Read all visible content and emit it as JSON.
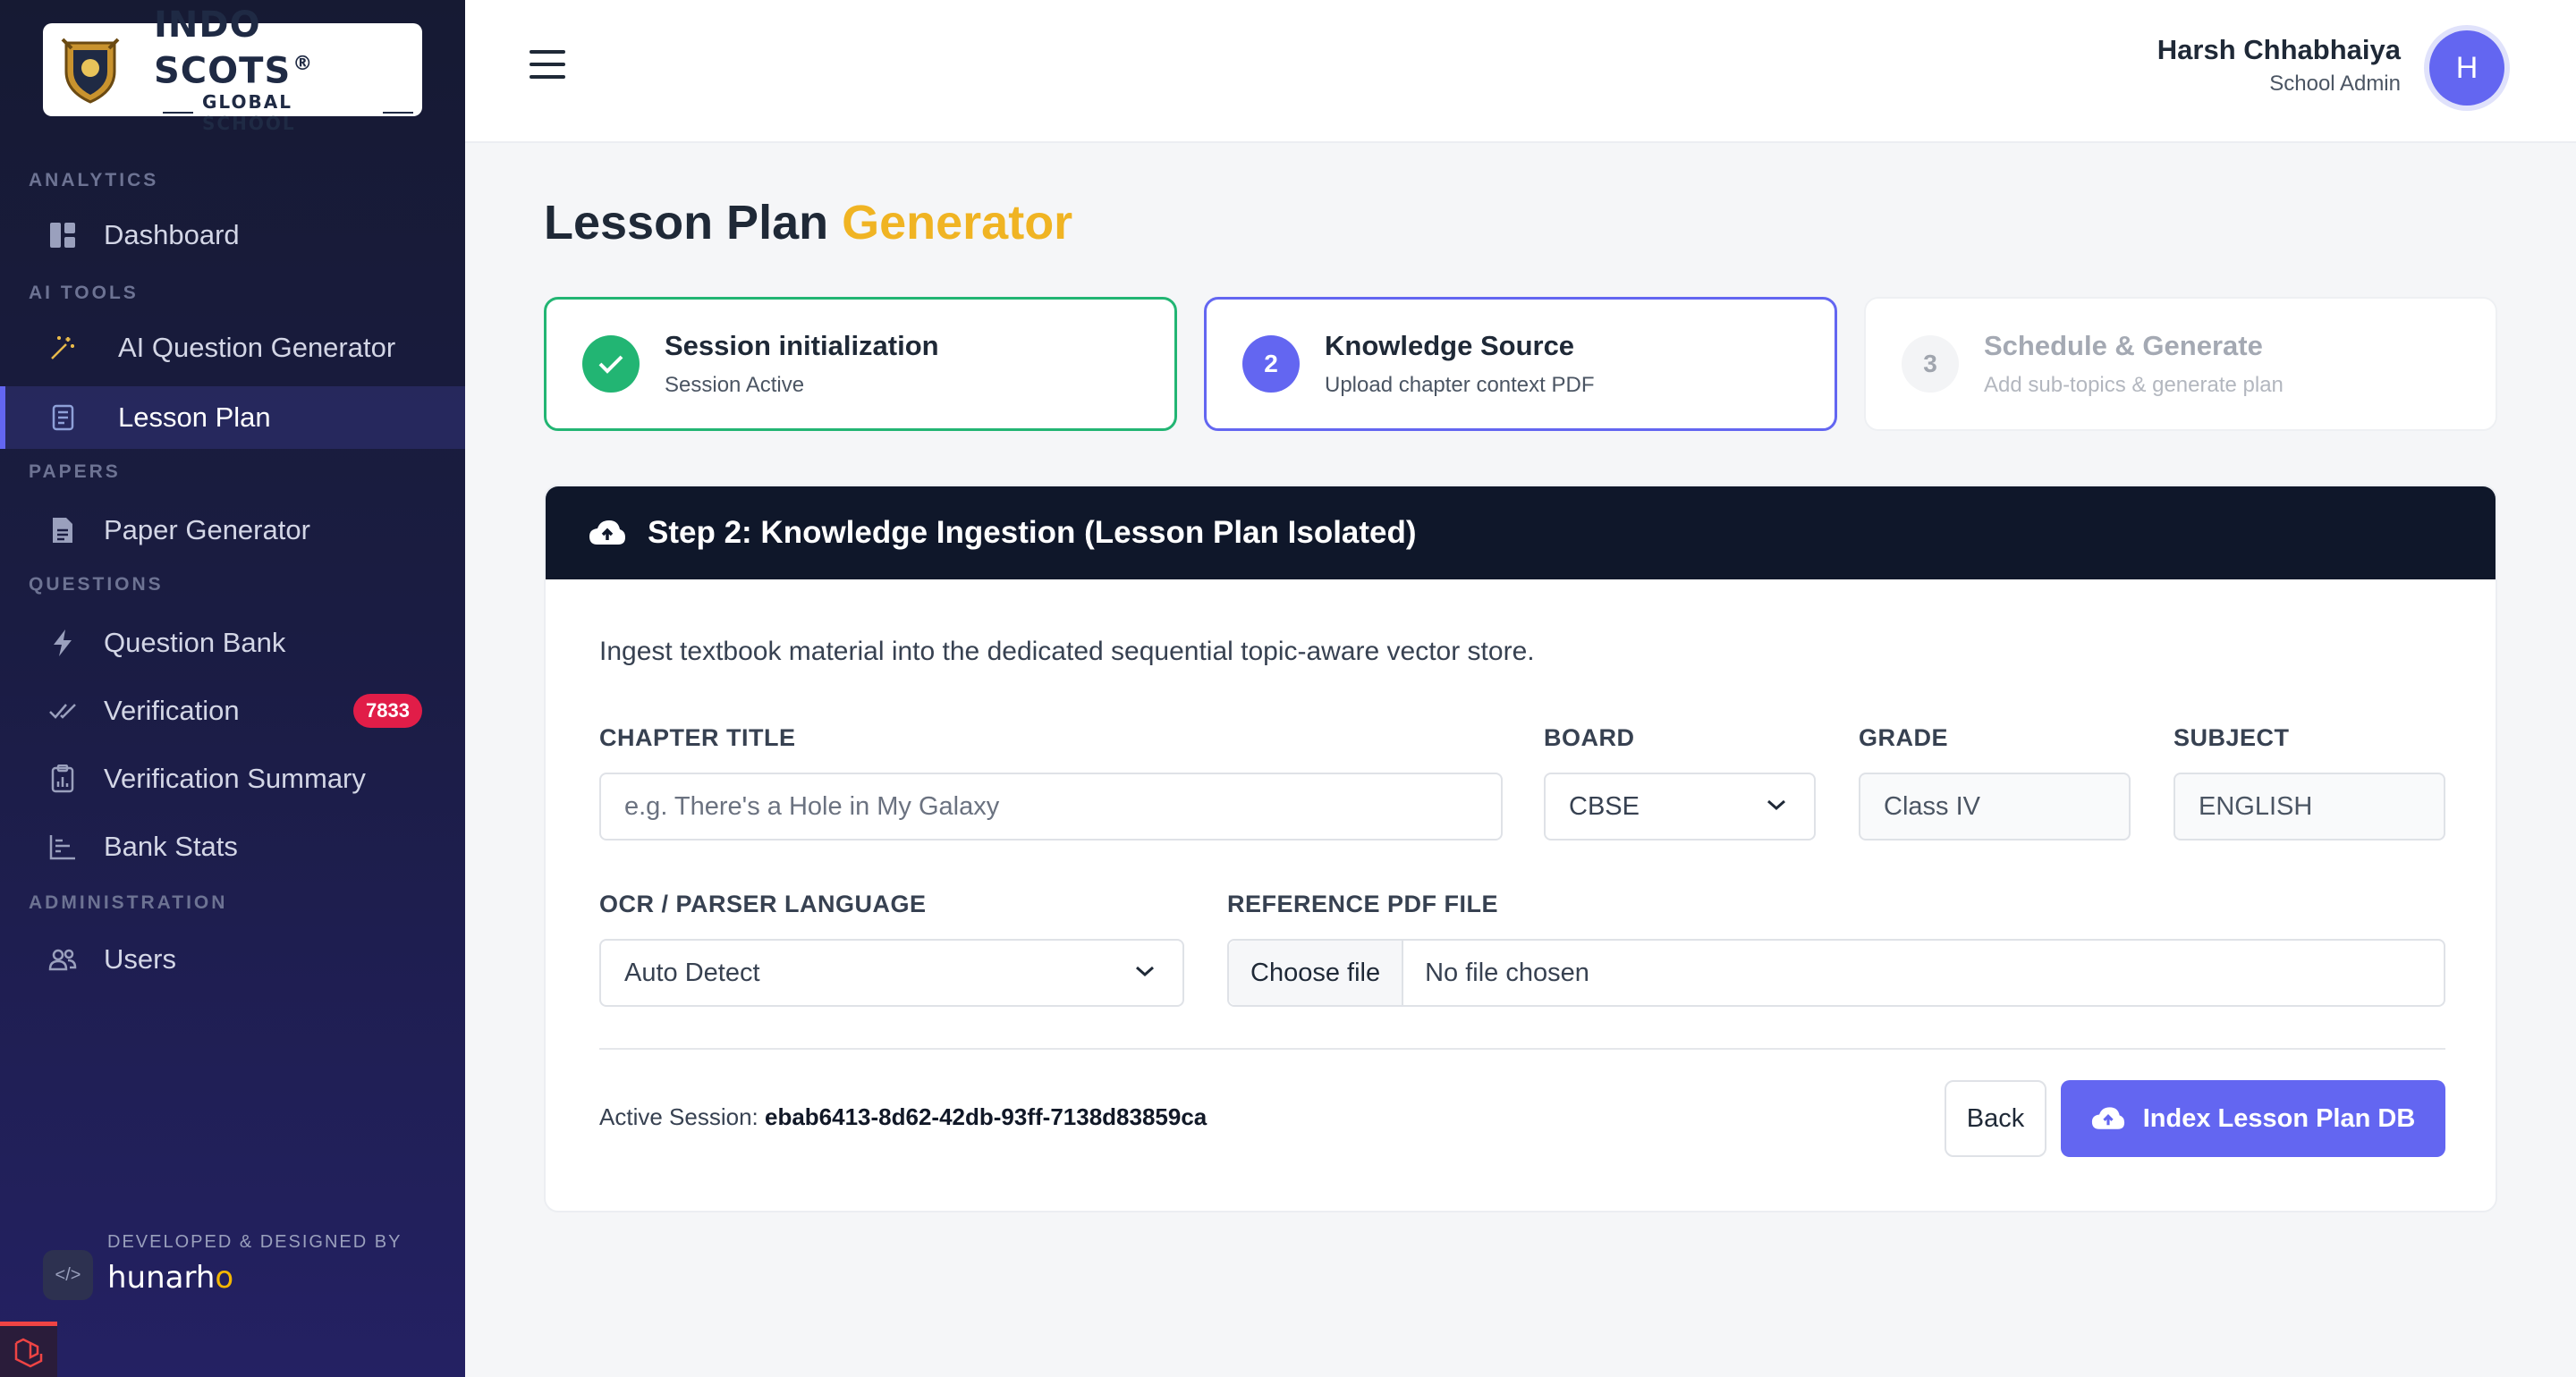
{
  "brand": {
    "name": "INDO SCOTS",
    "reg_mark": "®",
    "subtitle": "GLOBAL SCHOOL"
  },
  "sidebar": {
    "sections": [
      {
        "label": "ANALYTICS"
      },
      {
        "label": "AI TOOLS"
      },
      {
        "label": "PAPERS"
      },
      {
        "label": "QUESTIONS"
      },
      {
        "label": "ADMINISTRATION"
      }
    ],
    "items": [
      {
        "label": "Dashboard",
        "icon": "dashboard-icon"
      },
      {
        "label": "AI Question Generator",
        "icon": "magic-wand-icon"
      },
      {
        "label": "Lesson Plan",
        "icon": "lesson-book-icon",
        "active": true
      },
      {
        "label": "Paper Generator",
        "icon": "document-icon"
      },
      {
        "label": "Question Bank",
        "icon": "bolt-icon"
      },
      {
        "label": "Verification",
        "icon": "double-check-icon",
        "badge": "7833"
      },
      {
        "label": "Verification Summary",
        "icon": "clipboard-chart-icon"
      },
      {
        "label": "Bank Stats",
        "icon": "bar-stats-icon"
      },
      {
        "label": "Users",
        "icon": "users-icon"
      }
    ],
    "developer": {
      "label": "DEVELOPED & DESIGNED BY",
      "brand": "hunarho"
    }
  },
  "header": {
    "user_name": "Harsh Chhabhaiya",
    "user_role": "School Admin",
    "avatar_initial": "H"
  },
  "page": {
    "title_main": "Lesson Plan",
    "title_accent": "Generator",
    "accent_color": "#f0b423"
  },
  "steps": [
    {
      "number": "",
      "title": "Session initialization",
      "subtitle": "Session Active",
      "state": "done"
    },
    {
      "number": "2",
      "title": "Knowledge Source",
      "subtitle": "Upload chapter context PDF",
      "state": "active"
    },
    {
      "number": "3",
      "title": "Schedule & Generate",
      "subtitle": "Add sub-topics & generate plan",
      "state": "pending"
    }
  ],
  "card": {
    "title": "Step 2: Knowledge Ingestion (Lesson Plan Isolated)",
    "description": "Ingest textbook material into the dedicated sequential topic-aware vector store.",
    "fields": {
      "chapter_title": {
        "label": "CHAPTER TITLE",
        "placeholder": "e.g. There's a Hole in My Galaxy",
        "value": ""
      },
      "board": {
        "label": "BOARD",
        "value": "CBSE"
      },
      "grade": {
        "label": "GRADE",
        "value": "Class IV"
      },
      "subject": {
        "label": "SUBJECT",
        "value": "ENGLISH"
      },
      "ocr_language": {
        "label": "OCR / PARSER LANGUAGE",
        "value": "Auto Detect"
      },
      "reference_pdf": {
        "label": "REFERENCE PDF FILE",
        "button": "Choose file",
        "status": "No file chosen"
      }
    },
    "session_label": "Active Session:",
    "session_id": "ebab6413-8d62-42db-93ff-7138d83859ca",
    "back_label": "Back",
    "index_label": "Index Lesson Plan DB"
  },
  "colors": {
    "primary": "#6366f1",
    "success": "#22b573",
    "badge": "#e11d48",
    "header_dark": "#0f172a"
  }
}
